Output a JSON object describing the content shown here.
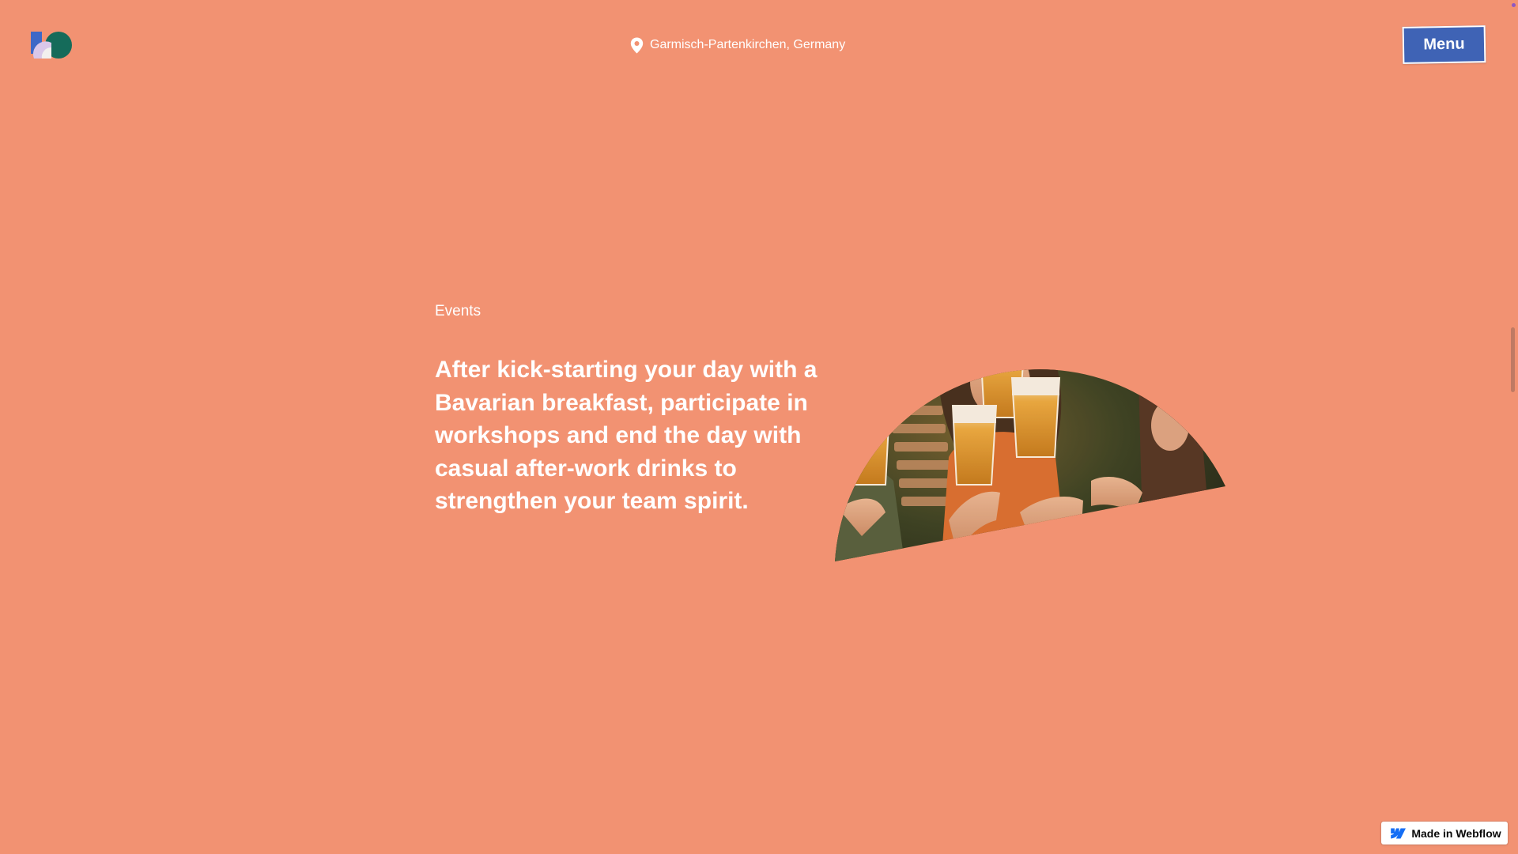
{
  "header": {
    "location": {
      "icon": "map-pin-icon",
      "text": "Garmisch-Partenkirchen, Germany"
    },
    "menu_button_label": "Menu",
    "logo_icon": "brand-logo-icon"
  },
  "main": {
    "section_label": "Events",
    "headline": "After kick-starting your day with a Bavarian breakfast, participate in workshops and end the day with casual after-work drinks to strengthen your team spirit.",
    "photo_subject": "people toasting beer glasses"
  },
  "badge": {
    "icon": "webflow-icon",
    "label": "Made in Webflow"
  },
  "colors": {
    "background": "#f29272",
    "menu_button": "#3f63b5",
    "logo_blue": "#3d68c7",
    "logo_green": "#156b5a",
    "text": "#ffffff"
  }
}
